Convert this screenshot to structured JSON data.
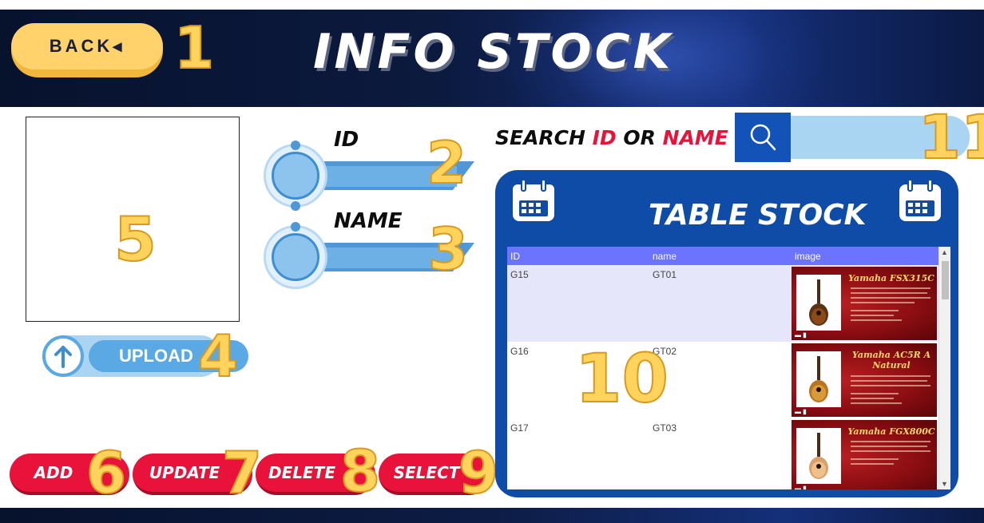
{
  "header": {
    "back_label": "BACK◂",
    "title": "INFO STOCK"
  },
  "annotations": {
    "n1": "1",
    "n2": "2",
    "n3": "3",
    "n4": "4",
    "n5": "5",
    "n6": "6",
    "n7": "7",
    "n8": "8",
    "n9": "9",
    "n10": "10",
    "n11": "11"
  },
  "form": {
    "id_label": "ID",
    "name_label": "NAME",
    "upload_label": "UPLOAD"
  },
  "actions": {
    "add": "ADD",
    "update": "UPDATE",
    "delete": "DELETE",
    "select": "SELECT"
  },
  "search": {
    "prefix": "SEARCH ",
    "id": "ID",
    "or": " OR ",
    "name": "NAME",
    "value": ""
  },
  "table": {
    "title": "TABLE STOCK",
    "columns": [
      "ID",
      "name",
      "image"
    ],
    "rows": [
      {
        "id": "G15",
        "name": "GT01",
        "image_title": "Yamaha FSX315C"
      },
      {
        "id": "G16",
        "name": "GT02",
        "image_title": "Yamaha AC5R A Natural"
      },
      {
        "id": "G17",
        "name": "GT03",
        "image_title": "Yamaha FGX800C"
      }
    ],
    "selected_row": 0
  },
  "colors": {
    "accent_red": "#e8123a",
    "panel_blue": "#0f4ca8",
    "header_purple": "#6b73ff",
    "annotation_gold": "#ffd35c"
  }
}
